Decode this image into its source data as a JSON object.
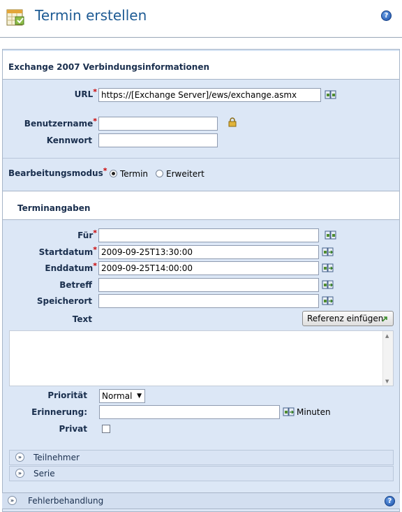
{
  "header": {
    "title": "Termin erstellen",
    "help_icon": "help-icon",
    "app_icon": "calendar-icon"
  },
  "exchange": {
    "title": "Exchange 2007 Verbindungsinformationen",
    "url_label": "URL",
    "url_value": "https://[Exchange Server]/ews/exchange.asmx",
    "username_label": "Benutzername",
    "username_value": "",
    "password_label": "Kennwort",
    "password_value": ""
  },
  "edit_mode": {
    "label": "Bearbeitungsmodus",
    "options": [
      "Termin",
      "Erweitert"
    ],
    "selected": "Termin"
  },
  "appointment": {
    "title": "Terminangaben",
    "for_label": "Für",
    "for_value": "",
    "start_label": "Startdatum",
    "start_value": "2009-09-25T13:30:00",
    "end_label": "Enddatum",
    "end_value": "2009-09-25T14:00:00",
    "subject_label": "Betreff",
    "subject_value": "",
    "location_label": "Speicherort",
    "location_value": "",
    "text_label": "Text",
    "insert_reference_label": "Referenz einfügen",
    "priority_label": "Priorität",
    "priority_value": "Normal",
    "reminder_label": "Erinnerung:",
    "reminder_value": "",
    "reminder_unit": "Minuten",
    "private_label": "Privat",
    "private_checked": false
  },
  "sections": {
    "participants": "Teilnehmer",
    "series": "Serie",
    "error_handling": "Fehlerbehandlung"
  },
  "colors": {
    "title_blue": "#1e5b94",
    "required_red": "#cc0000",
    "panel_bg": "#dce7f6"
  }
}
